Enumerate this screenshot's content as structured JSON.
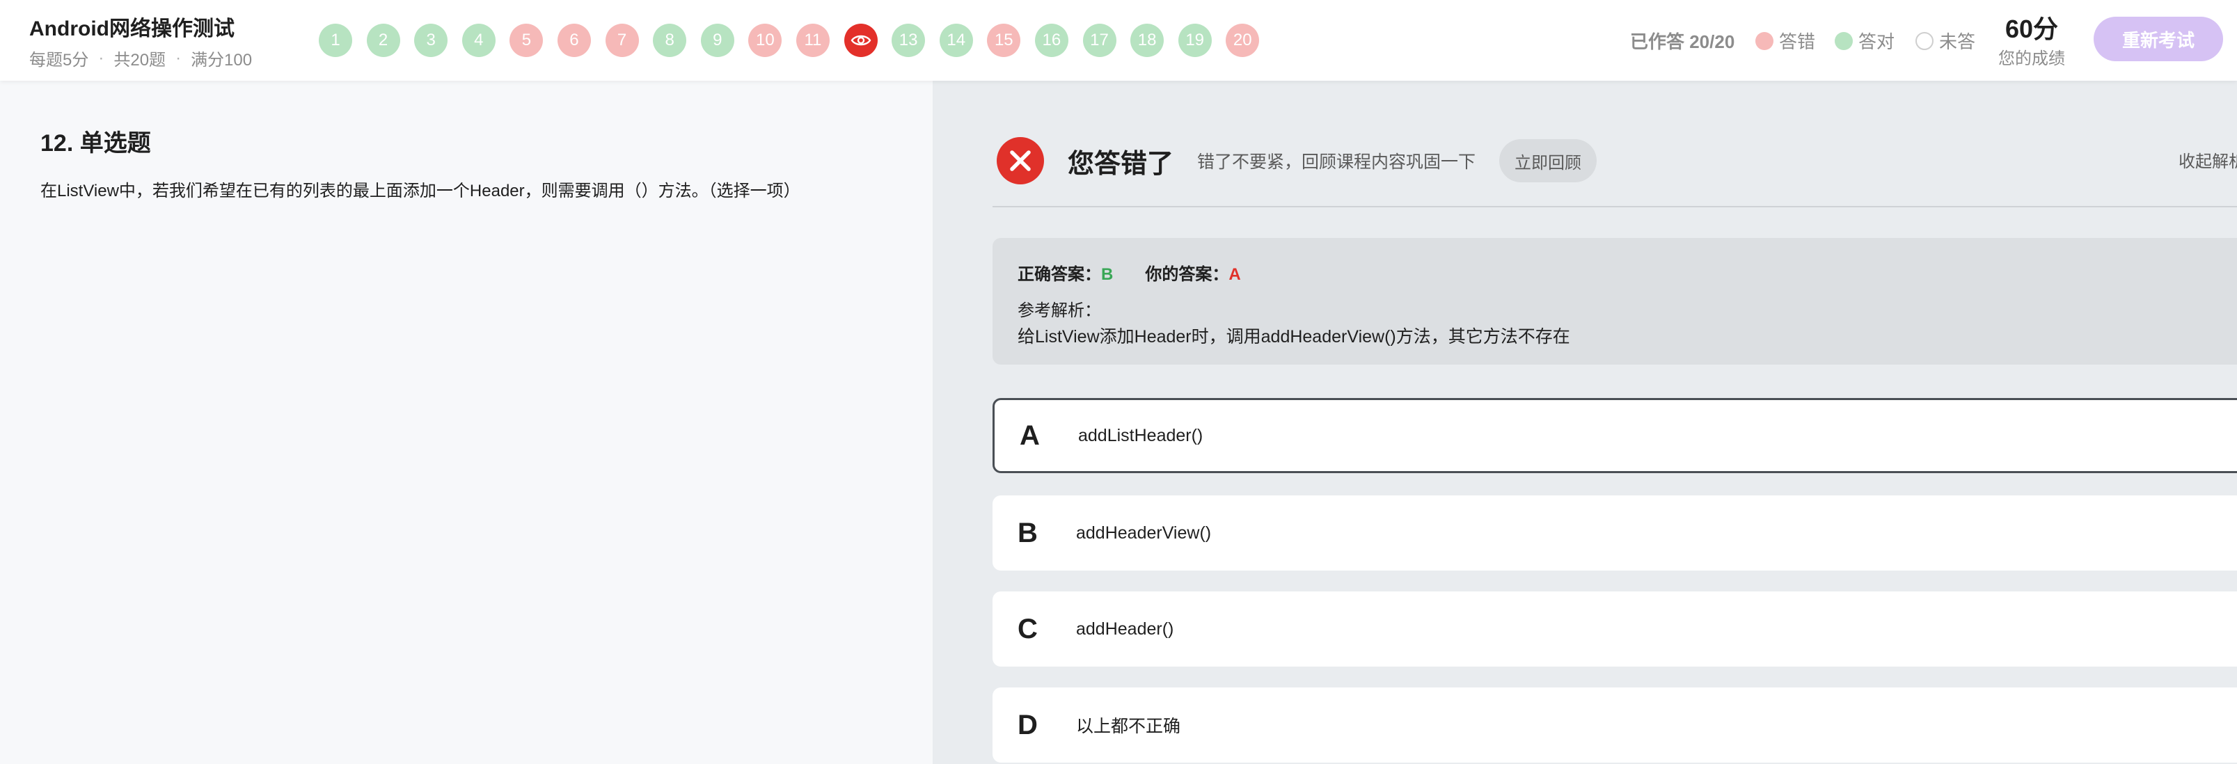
{
  "header": {
    "title": "Android网络操作测试",
    "meta": [
      "每题5分",
      "共20题",
      "满分100"
    ],
    "meta_separator": "·",
    "questions": [
      {
        "label": "1",
        "status": "correct"
      },
      {
        "label": "2",
        "status": "correct"
      },
      {
        "label": "3",
        "status": "correct"
      },
      {
        "label": "4",
        "status": "correct"
      },
      {
        "label": "5",
        "status": "wrong"
      },
      {
        "label": "6",
        "status": "wrong"
      },
      {
        "label": "7",
        "status": "wrong"
      },
      {
        "label": "8",
        "status": "correct"
      },
      {
        "label": "9",
        "status": "correct"
      },
      {
        "label": "10",
        "status": "wrong"
      },
      {
        "label": "11",
        "status": "wrong"
      },
      {
        "label": "",
        "status": "current",
        "icon": "eye-icon"
      },
      {
        "label": "13",
        "status": "correct"
      },
      {
        "label": "14",
        "status": "correct"
      },
      {
        "label": "15",
        "status": "wrong"
      },
      {
        "label": "16",
        "status": "correct"
      },
      {
        "label": "17",
        "status": "correct"
      },
      {
        "label": "18",
        "status": "correct"
      },
      {
        "label": "19",
        "status": "correct"
      },
      {
        "label": "20",
        "status": "wrong"
      }
    ],
    "answered": "已作答 20/20",
    "legend_wrong": "答错",
    "legend_correct": "答对",
    "legend_unanswered": "未答",
    "score_value": "60分",
    "score_label": "您的成绩",
    "retake_label": "重新考试"
  },
  "question": {
    "heading": "12. 单选题",
    "text": "在ListView中，若我们希望在已有的列表的最上面添加一个Header，则需要调用（）方法。（选择一项）"
  },
  "result": {
    "title": "您答错了",
    "subtitle": "错了不要紧，回顾课程内容巩固一下",
    "review_label": "立即回顾",
    "collapse_label": "收起解析",
    "correct_answer_label": "正确答案：",
    "correct_answer": "B",
    "your_answer_label": "你的答案：",
    "your_answer": "A",
    "reference_label": "参考解析：",
    "reference_text": "给ListView添加Header时，调用addHeaderView()方法，其它方法不存在"
  },
  "options": [
    {
      "letter": "A",
      "text": "addListHeader()"
    },
    {
      "letter": "B",
      "text": "addHeaderView()"
    },
    {
      "letter": "C",
      "text": "addHeader()"
    },
    {
      "letter": "D",
      "text": "以上都不正确"
    }
  ],
  "colors": {
    "correct": "#b7e3c1",
    "wrong": "#f6b9b8",
    "current": "#e3302a",
    "accent_purple": "#d6c2f4",
    "answer_ok": "#3aa757",
    "answer_bad": "#e0312a"
  }
}
